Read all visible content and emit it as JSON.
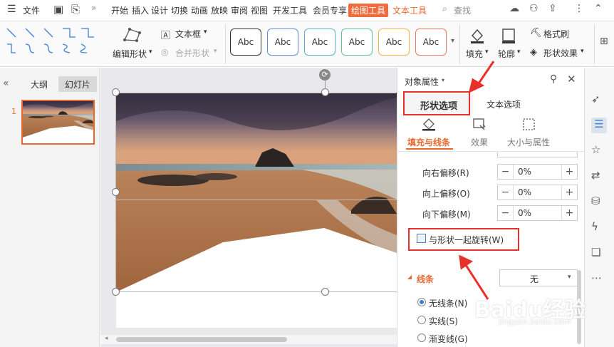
{
  "menubar": {
    "file": "文件",
    "tabs": [
      "开始",
      "插入",
      "设计",
      "切换",
      "动画",
      "放映",
      "审阅",
      "视图",
      "开发工具",
      "会员专享"
    ],
    "drawing_tools": "绘图工具",
    "text_tools": "文本工具",
    "search": "查找"
  },
  "ribbon": {
    "edit_shape": "编辑形状",
    "textbox": "文本框",
    "merge_shape": "合并形状",
    "style_label": "Abc",
    "fill": "填充",
    "outline": "轮廓",
    "format_painter": "格式刷",
    "shape_effects": "形状效果"
  },
  "left_panel": {
    "tabs": [
      "大纲",
      "幻灯片"
    ],
    "slide_number": "1"
  },
  "props": {
    "title": "对象属性",
    "tabs": [
      "形状选项",
      "文本选项"
    ],
    "subtabs": [
      "填充与线条",
      "效果",
      "大小与属性"
    ],
    "rows": [
      {
        "label": "向右偏移(R)",
        "value": "0%"
      },
      {
        "label": "向上偏移(O)",
        "value": "0%"
      },
      {
        "label": "向下偏移(M)",
        "value": "0%"
      }
    ],
    "rotate_checkbox": "与形状一起旋转(W)",
    "line_section": "线条",
    "line_select": "无",
    "radios": [
      "无线条(N)",
      "实线(S)",
      "渐变线(G)"
    ]
  },
  "watermark": {
    "brand": "Baidu经验",
    "url": "jingyan.baidu.com"
  },
  "colors": {
    "accent": "#e8692f",
    "annotation": "#e8312a",
    "link_blue": "#3f7fd8"
  }
}
